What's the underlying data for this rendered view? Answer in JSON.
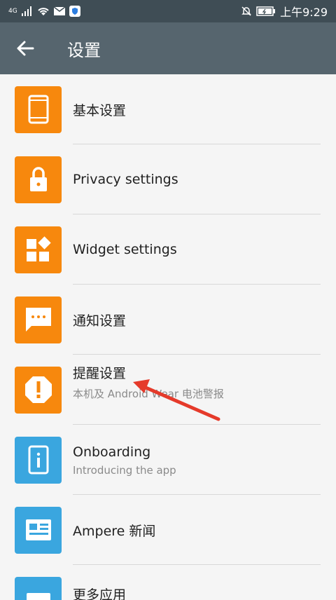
{
  "status_bar": {
    "network": "4G",
    "time": "上午9:29"
  },
  "app_bar": {
    "title": "设置"
  },
  "items": [
    {
      "icon": "phone-icon",
      "title": "基本设置",
      "subtitle": ""
    },
    {
      "icon": "lock-icon",
      "title": "Privacy settings",
      "subtitle": ""
    },
    {
      "icon": "widgets-icon",
      "title": "Widget settings",
      "subtitle": ""
    },
    {
      "icon": "message-icon",
      "title": "通知设置",
      "subtitle": ""
    },
    {
      "icon": "alert-icon",
      "title": "提醒设置",
      "subtitle": "本机及 Android Wear 电池警报"
    },
    {
      "icon": "info-phone-icon",
      "title": "Onboarding",
      "subtitle": "Introducing the app"
    },
    {
      "icon": "news-icon",
      "title": "Ampere 新闻",
      "subtitle": ""
    },
    {
      "icon": "apps-icon",
      "title": "更多应用",
      "subtitle": ""
    }
  ],
  "colors": {
    "status_bar": "#3f4d55",
    "app_bar": "#56656e",
    "orange": "#f7880d",
    "blue": "#3aa6df",
    "annotation_arrow": "#e53a2a"
  }
}
